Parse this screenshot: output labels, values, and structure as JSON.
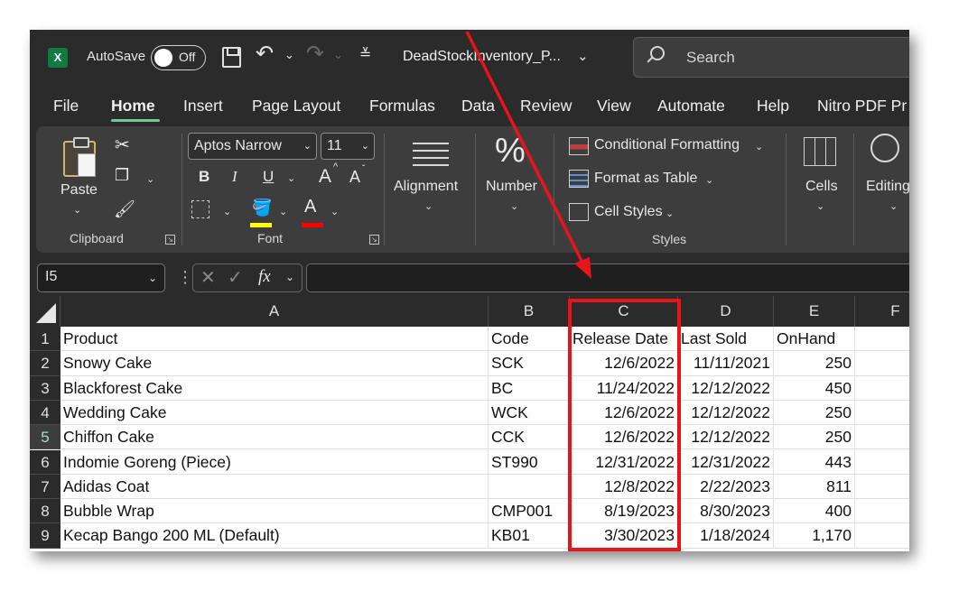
{
  "titlebar": {
    "app_logo": "X",
    "autosave_label": "AutoSave",
    "autosave_state": "Off",
    "doc_title": "DeadStockInventory_P...",
    "search_placeholder": "Search",
    "icons": [
      "excel-logo-icon",
      "save-icon",
      "undo-icon",
      "redo-icon",
      "customize-qat-icon",
      "chevron-down-icon",
      "search-icon"
    ]
  },
  "menu": {
    "tabs": [
      "File",
      "Home",
      "Insert",
      "Page Layout",
      "Formulas",
      "Data",
      "Review",
      "View",
      "Automate",
      "Help",
      "Nitro PDF Pr"
    ],
    "active": "Home",
    "accent_color": "#73c59b"
  },
  "ribbon": {
    "clipboard": {
      "paste_label": "Paste",
      "group_label": "Clipboard"
    },
    "font": {
      "font_name": "Aptos Narrow",
      "font_size": "11",
      "group_label": "Font",
      "bold": "B",
      "italic": "I",
      "underline": "U",
      "grow": "A",
      "shrink": "A",
      "font_color_letter": "A",
      "fill_color": "#ffff00",
      "font_color": "#ff0000"
    },
    "alignment": {
      "label": "Alignment"
    },
    "number": {
      "label": "Number",
      "icon_glyph": "%"
    },
    "styles": {
      "conditional_formatting": "Conditional Formatting",
      "format_as_table": "Format as Table",
      "cell_styles": "Cell Styles",
      "group_label": "Styles"
    },
    "cells": {
      "label": "Cells"
    },
    "editing": {
      "label": "Editing"
    }
  },
  "formula_bar": {
    "name_box": "I5",
    "fx_label": "fx",
    "formula_value": ""
  },
  "sheet": {
    "columns": [
      "A",
      "B",
      "C",
      "D",
      "E",
      "F"
    ],
    "row_numbers": [
      "1",
      "2",
      "3",
      "4",
      "5",
      "6",
      "7",
      "8",
      "9"
    ],
    "selected_row": "5",
    "header": {
      "product": "Product",
      "code": "Code",
      "release_date": "Release Date",
      "last_sold": "Last Sold",
      "onhand": "OnHand"
    },
    "rows": [
      {
        "product": "Snowy Cake",
        "code": "SCK",
        "release_date": "12/6/2022",
        "last_sold": "11/11/2021",
        "onhand": "250"
      },
      {
        "product": "Blackforest Cake",
        "code": "BC",
        "release_date": "11/24/2022",
        "last_sold": "12/12/2022",
        "onhand": "450"
      },
      {
        "product": "Wedding Cake",
        "code": "WCK",
        "release_date": "12/6/2022",
        "last_sold": "12/12/2022",
        "onhand": "250"
      },
      {
        "product": "Chiffon Cake",
        "code": "CCK",
        "release_date": "12/6/2022",
        "last_sold": "12/12/2022",
        "onhand": "250"
      },
      {
        "product": "Indomie Goreng (Piece)",
        "code": "ST990",
        "release_date": "12/31/2022",
        "last_sold": "12/31/2022",
        "onhand": "443"
      },
      {
        "product": "Adidas Coat",
        "code": "",
        "release_date": "12/8/2022",
        "last_sold": "2/22/2023",
        "onhand": "811"
      },
      {
        "product": "Bubble Wrap",
        "code": "CMP001",
        "release_date": "8/19/2023",
        "last_sold": "8/30/2023",
        "onhand": "400"
      },
      {
        "product": "Kecap Bango 200 ML (Default)",
        "code": "KB01",
        "release_date": "3/30/2023",
        "last_sold": "1/18/2024",
        "onhand": "1,170"
      }
    ]
  },
  "annotation": {
    "highlight_color": "#e8141a",
    "highlighted_column": "C"
  }
}
